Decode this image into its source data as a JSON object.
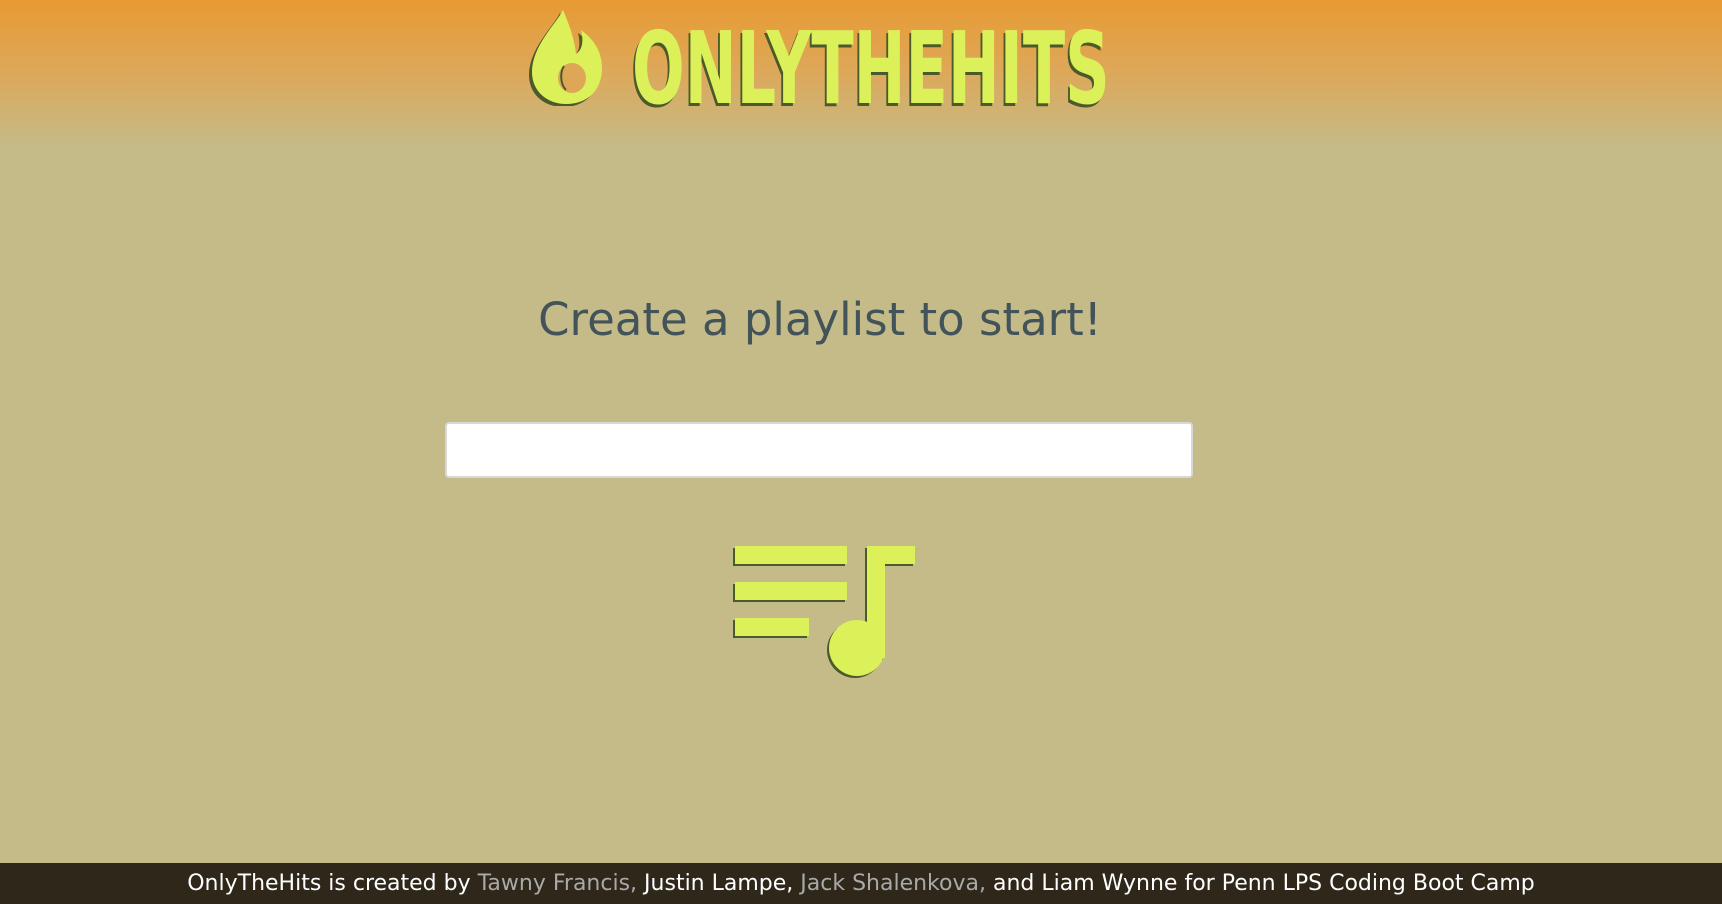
{
  "header": {
    "brand_name": "ONLYTHEHITS",
    "logo_icon": "flame-icon",
    "brand_color": "#dcf05a"
  },
  "main": {
    "heading": "Create a playlist to start!",
    "playlist_input": {
      "value": "",
      "placeholder": ""
    },
    "create_button_icon": "playlist-add-music-icon"
  },
  "footer": {
    "intro": "OnlyTheHits is created by",
    "authors": [
      {
        "name": "Tawny Francis,"
      },
      {
        "name": "Justin Lampe,"
      },
      {
        "name": "Jack Shalenkova,"
      },
      {
        "name": "Liam Wynne"
      }
    ],
    "and_text": "and",
    "suffix": "for Penn LPS Coding Boot Camp"
  },
  "colors": {
    "header_orange": "#e89a33",
    "page_background": "#c4bb89",
    "heading_text": "#43535a",
    "footer_background": "#2e271a",
    "footer_link_muted": "#a9a9a9"
  }
}
